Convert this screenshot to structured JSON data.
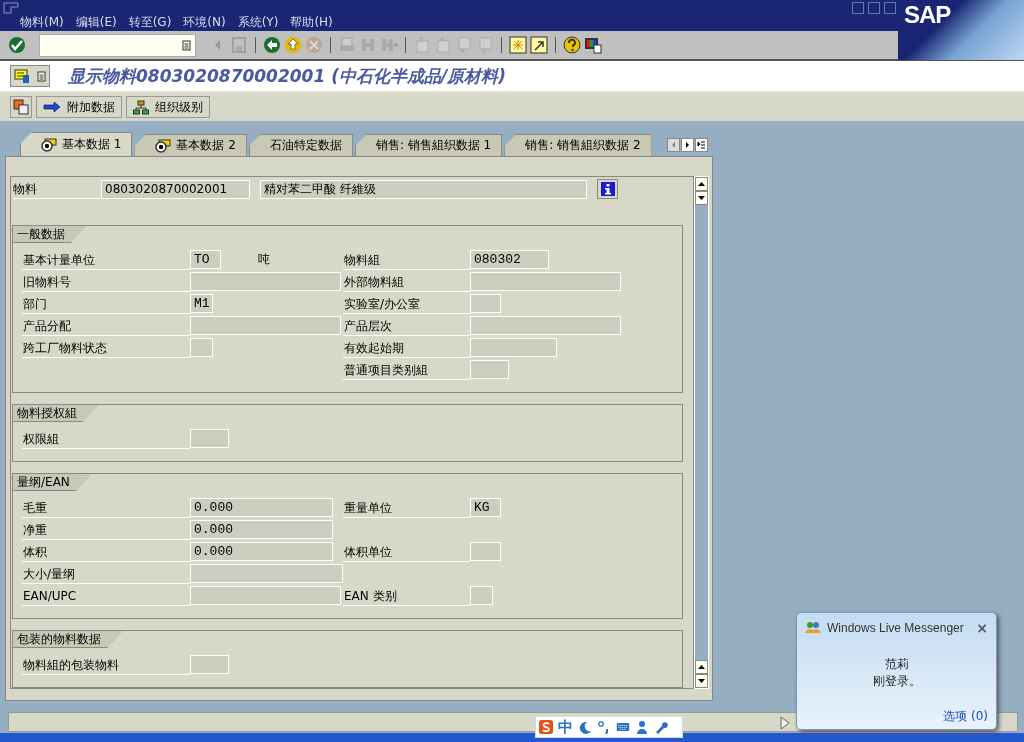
{
  "window": {
    "menu": [
      {
        "label": "物料(M)"
      },
      {
        "label": "编辑(E)"
      },
      {
        "label": "转至(G)"
      },
      {
        "label": "环境(N)"
      },
      {
        "label": "系统(Y)"
      },
      {
        "label": "帮助(H)"
      }
    ],
    "logo": "SAP"
  },
  "toolbar": [
    {
      "kind": "enter",
      "disabled": false
    },
    {
      "kind": "command"
    },
    {
      "kind": "left",
      "disabled": true
    },
    {
      "kind": "save",
      "disabled": true
    },
    {
      "kind": "sep"
    },
    {
      "kind": "back",
      "disabled": false
    },
    {
      "kind": "exit",
      "disabled": false
    },
    {
      "kind": "cancel",
      "disabled": true
    },
    {
      "kind": "sep"
    },
    {
      "kind": "print",
      "disabled": true
    },
    {
      "kind": "find",
      "disabled": true
    },
    {
      "kind": "findnext",
      "disabled": true
    },
    {
      "kind": "sep"
    },
    {
      "kind": "first",
      "disabled": true
    },
    {
      "kind": "prev",
      "disabled": true
    },
    {
      "kind": "next",
      "disabled": true
    },
    {
      "kind": "last",
      "disabled": true
    },
    {
      "kind": "sep"
    },
    {
      "kind": "session",
      "disabled": false
    },
    {
      "kind": "shortcut",
      "disabled": false
    },
    {
      "kind": "sep"
    },
    {
      "kind": "help",
      "disabled": false
    },
    {
      "kind": "layout",
      "disabled": false
    }
  ],
  "title": "显示物料0803020870002001 (中石化半成品/原材料)",
  "app_toolbar": [
    {
      "kind": "icon"
    },
    {
      "kind": "arrow",
      "label": "附加数据"
    },
    {
      "kind": "org",
      "label": "组织级别"
    }
  ],
  "tabs": [
    {
      "label": "基本数据 1",
      "kind": "icon",
      "selected": true
    },
    {
      "label": "基本数据 2",
      "kind": "icon",
      "selected": false
    },
    {
      "label": "石油特定数据",
      "kind": "plain",
      "selected": false
    },
    {
      "label": "销售: 销售組织数据 1",
      "kind": "plain",
      "selected": false
    },
    {
      "label": "销售: 销售組织数据 2",
      "kind": "plain",
      "selected": false
    }
  ],
  "header": {
    "label": "物料",
    "value": "0803020870002001",
    "description": "精对苯二甲酸 纤維级"
  },
  "groups": [
    {
      "title": "一般数据",
      "rows": [
        {
          "left": {
            "label": "基本计量单位",
            "kind": "unit",
            "value": "TO",
            "unit_text": "吨"
          },
          "right": {
            "label": "物料組",
            "kind": "code",
            "value": "080302"
          }
        },
        {
          "left": {
            "label": "旧物料号",
            "kind": "text"
          },
          "right": {
            "label": "外部物料組",
            "kind": "text"
          }
        },
        {
          "left": {
            "label": "部门",
            "kind": "flag",
            "value": "M1"
          },
          "right": {
            "label": "实验室/办公室",
            "kind": "unit"
          }
        },
        {
          "left": {
            "label": "产品分配",
            "kind": "text"
          },
          "right": {
            "label": "产品层次",
            "kind": "text"
          }
        },
        {
          "left": {
            "label": "跨工厂物料状态",
            "kind": "flag"
          },
          "right": {
            "label": "有效起始期",
            "kind": "date"
          }
        },
        {
          "right": {
            "label": "普通项目类别組",
            "kind": "key"
          }
        }
      ]
    },
    {
      "title": "物料授权組",
      "rows": [
        {
          "left": {
            "label": "权限組",
            "kind": "key"
          }
        }
      ]
    },
    {
      "title": "量纲/EAN",
      "rows": [
        {
          "left": {
            "label": "毛重",
            "kind": "quantity",
            "value": "0.000"
          },
          "right": {
            "label": "重量单位",
            "kind": "unit",
            "value": "KG"
          }
        },
        {
          "left": {
            "label": "净重",
            "kind": "quantity",
            "value": "0.000"
          }
        },
        {
          "left": {
            "label": "体积",
            "kind": "quantity",
            "value": "0.000"
          },
          "right": {
            "label": "体积单位",
            "kind": "unit"
          }
        },
        {
          "left": {
            "label": "大小/量纲",
            "kind": "long"
          }
        },
        {
          "left": {
            "label": "EAN/UPC",
            "kind": "text"
          },
          "right": {
            "label": "EAN 类别",
            "kind": "flag"
          }
        }
      ]
    },
    {
      "title": "包装的物料数据",
      "rows": [
        {
          "left": {
            "label": "物料組的包装物料",
            "kind": "key"
          }
        }
      ]
    }
  ],
  "ime_bar": {
    "mode": "中"
  },
  "notification": {
    "app": "Windows Live Messenger",
    "close": "×",
    "lines": [
      "范莉",
      "刚登录。"
    ],
    "link": "选项 (0)"
  }
}
